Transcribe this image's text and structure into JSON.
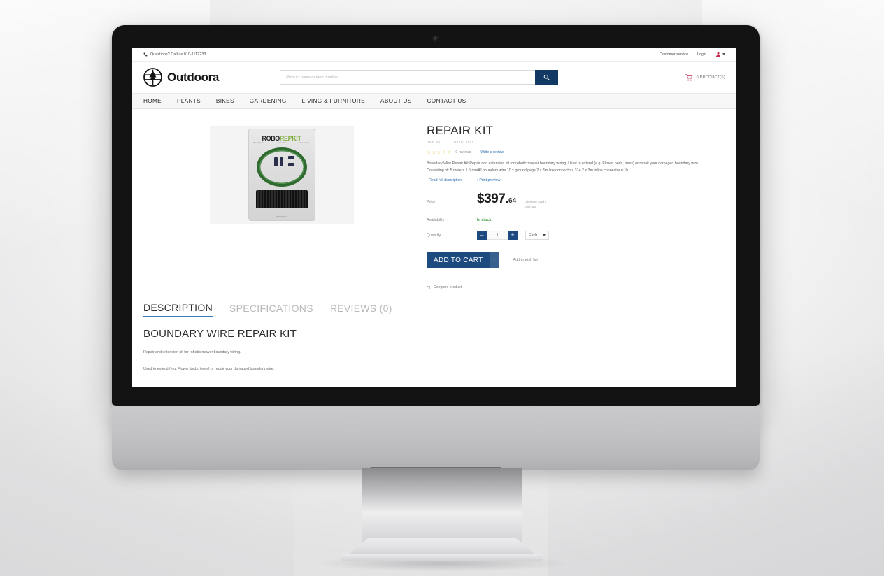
{
  "topbar": {
    "phone_icon": "phone-icon",
    "phone_text": "Questions? Call us 010-1112233",
    "customer_service": "Customer service",
    "login": "Login",
    "user_icon": "user-icon"
  },
  "header": {
    "brand_name": "Outdoora",
    "brand_icon": "outdoora-logo-icon",
    "search_placeholder": "Product name or item number...",
    "search_value": "",
    "search_icon": "search-icon",
    "cart_icon": "shopping-cart-icon",
    "cart_text": "0 PRODUCT(S)"
  },
  "nav": {
    "items": [
      {
        "label": "HOME"
      },
      {
        "label": "PLANTS"
      },
      {
        "label": "BIKES"
      },
      {
        "label": "GARDENING"
      },
      {
        "label": "LIVING & FURNITURE"
      },
      {
        "label": "ABOUT US"
      },
      {
        "label": "CONTACT US"
      }
    ]
  },
  "product": {
    "image": {
      "pack_brand_a": "ROBO",
      "pack_brand_b": "REPKIT",
      "pack_sub_1": "Boundary wire",
      "pack_sub_2": "Connectors",
      "pack_sub_3": "Ground pegs",
      "pack_footer": "robioparts"
    },
    "title": "REPAIR KIT",
    "item_label": "Item No.",
    "item_number": "R7101-020",
    "stars": "☆☆☆☆☆",
    "review_count": "0 reviews",
    "write_review": "Write a review",
    "description": "Boundary Wire Repair Kit Repair and extension kit for robotic mower boundary wiring. Used to extend (e.g. Flower beds, trees) or repair your damaged boundary wire. Consisting of: 5 meters 1.5 mmA² boundary wire 10 x ground pegs 2 x 3m line connectors 314 2 x 3m inline connector u 1b",
    "read_full": "› Read full description",
    "print_preview": "› Print preview",
    "price_label": "Price",
    "price_main": "$397.",
    "price_cents": "64",
    "price_note_1": "price per Each",
    "price_note_2": "excl. tax",
    "availability_label": "Availability",
    "availability_value": "In stock",
    "quantity_label": "Quantity",
    "qty_minus": "–",
    "qty_value": "1",
    "qty_plus": "+",
    "unit": "Each",
    "add_to_cart": "ADD TO CART",
    "add_to_cart_chevron": "›",
    "wish_list": "Add to wish list",
    "compare": "Compare product"
  },
  "tabs": {
    "items": [
      {
        "label": "DESCRIPTION",
        "active": true
      },
      {
        "label": "SPECIFICATIONS",
        "active": false
      },
      {
        "label": "REVIEWS (0)",
        "active": false
      }
    ]
  },
  "description_panel": {
    "heading": "BOUNDARY WIRE REPAIR KIT",
    "p1": "Repair and extension kit for robotic mower boundary wiring.",
    "p2": "Used to extend (e.g. Flower beds, trees) or repair your damaged boundary wire."
  },
  "colors": {
    "accent_blue": "#1d4b80",
    "search_blue": "#123963",
    "link_blue": "#2f6fb0",
    "in_stock_green": "#3d9a3d",
    "cart_red": "#c0274a",
    "star_gold": "#e8c14a"
  }
}
